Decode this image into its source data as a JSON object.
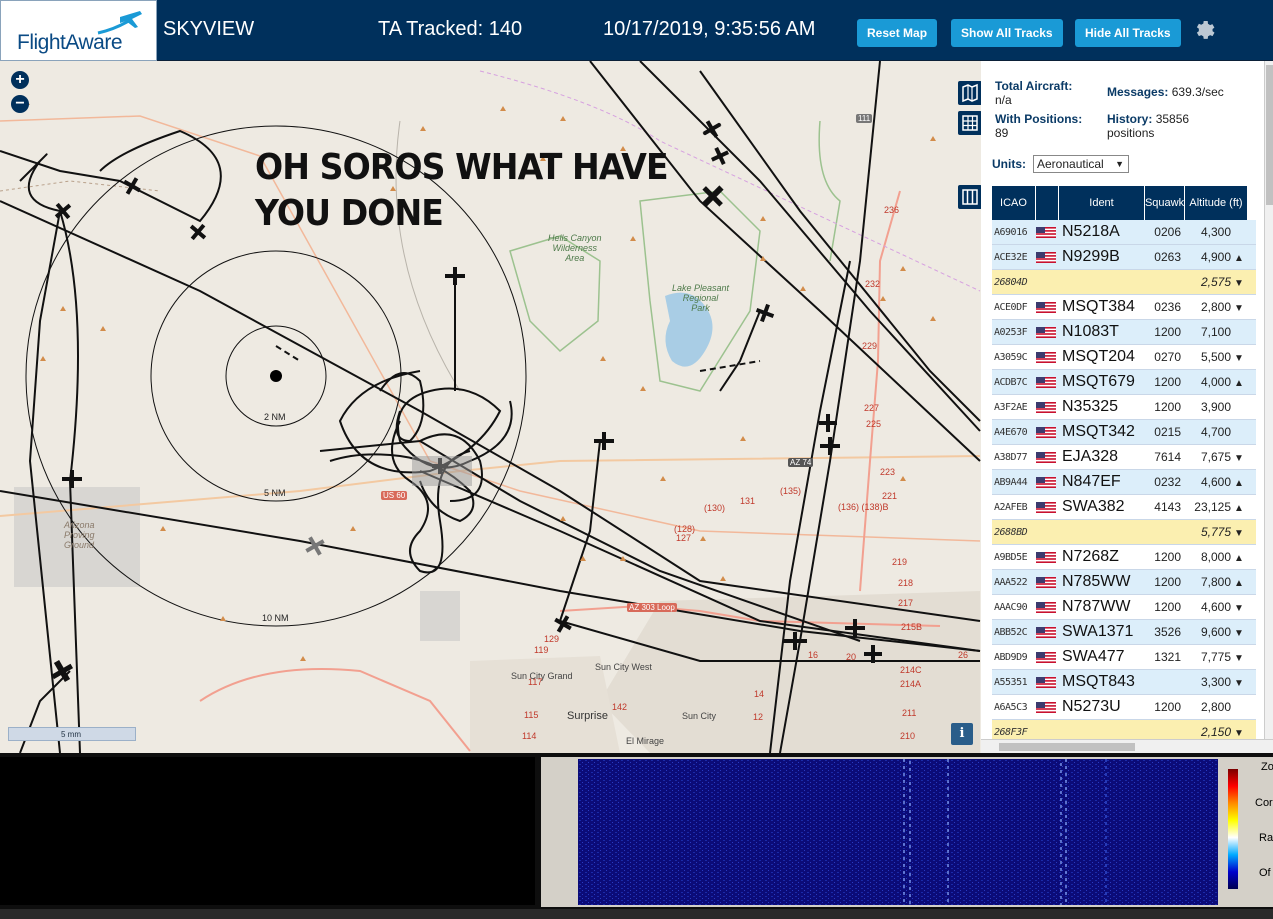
{
  "header": {
    "logo_text": "FlightAware",
    "app_name": "SKYVIEW",
    "ta_tracked": "TA Tracked: 140",
    "datetime": "10/17/2019, 9:35:56 AM",
    "buttons": {
      "reset_map": "Reset Map",
      "show_all": "Show All Tracks",
      "hide_all": "Hide All Tracks"
    }
  },
  "map": {
    "overlay_text_line1": "OH SOROS WHAT HAVE",
    "overlay_text_line2": "YOU DONE",
    "zoom_in": "+",
    "zoom_out": "−",
    "range_rings": [
      "2 NM",
      "5 NM",
      "10 NM"
    ],
    "places": {
      "hells_canyon": "Hells Canyon\nWilderness\nArea",
      "lake_pleasant": "Lake Pleasant\nRegional\nPark",
      "sun_city_grand": "Sun City Grand",
      "sun_city_west": "Sun City West",
      "surprise": "Surprise",
      "sun_city": "Sun City",
      "el_mirage": "El Mirage",
      "proving_ground": "Arizona\nProving\nGround"
    },
    "highways": [
      "US 60",
      "AZ 74",
      "AZ 303 Loop",
      "111",
      "236",
      "232",
      "229",
      "227",
      "225",
      "223",
      "221",
      "219",
      "218",
      "217",
      "215B",
      "214C",
      "214A",
      "211",
      "210",
      "(130)",
      "(135)",
      "131",
      "(136) (138)B",
      "(128)",
      "127",
      "129",
      "119",
      "117",
      "115",
      "114",
      "142",
      "14",
      "12",
      "16",
      "26",
      "20"
    ],
    "scale_label": "5 mm",
    "info_label": "i"
  },
  "sidebar": {
    "total_aircraft_label": "Total Aircraft:",
    "total_aircraft_value": "n/a",
    "with_positions_label": "With Positions:",
    "with_positions_value": "89",
    "messages_label": "Messages:",
    "messages_value": "639.3/sec",
    "history_label": "History:",
    "history_value": "35856 positions",
    "units_label": "Units:",
    "units_value": "Aeronautical",
    "columns": {
      "icao": "ICAO",
      "ident": "Ident",
      "squawk": "Squawk",
      "altitude": "Altitude (ft)"
    },
    "rows": [
      {
        "icao": "A69016",
        "flag": "us",
        "ident": "N5218A",
        "squawk": "0206",
        "alt": "4,300",
        "trend": "",
        "style": "blue"
      },
      {
        "icao": "ACE32E",
        "flag": "us",
        "ident": "N9299B",
        "squawk": "0263",
        "alt": "4,900",
        "trend": "▲",
        "style": "blue"
      },
      {
        "icao": "26804D",
        "flag": "",
        "ident": "",
        "squawk": "",
        "alt": "2,575",
        "trend": "▼",
        "style": "yellow"
      },
      {
        "icao": "ACE0DF",
        "flag": "us",
        "ident": "MSQT384",
        "squawk": "0236",
        "alt": "2,800",
        "trend": "▼",
        "style": "white"
      },
      {
        "icao": "A0253F",
        "flag": "us",
        "ident": "N1083T",
        "squawk": "1200",
        "alt": "7,100",
        "trend": "",
        "style": "blue"
      },
      {
        "icao": "A3059C",
        "flag": "us",
        "ident": "MSQT204",
        "squawk": "0270",
        "alt": "5,500",
        "trend": "▼",
        "style": "white"
      },
      {
        "icao": "ACDB7C",
        "flag": "us",
        "ident": "MSQT679",
        "squawk": "1200",
        "alt": "4,000",
        "trend": "▲",
        "style": "blue"
      },
      {
        "icao": "A3F2AE",
        "flag": "us",
        "ident": "N35325",
        "squawk": "1200",
        "alt": "3,900",
        "trend": "",
        "style": "white"
      },
      {
        "icao": "A4E670",
        "flag": "us",
        "ident": "MSQT342",
        "squawk": "0215",
        "alt": "4,700",
        "trend": "",
        "style": "blue"
      },
      {
        "icao": "A38D77",
        "flag": "us",
        "ident": "EJA328",
        "squawk": "7614",
        "alt": "7,675",
        "trend": "▼",
        "style": "white"
      },
      {
        "icao": "AB9A44",
        "flag": "us",
        "ident": "N847EF",
        "squawk": "0232",
        "alt": "4,600",
        "trend": "▲",
        "style": "blue"
      },
      {
        "icao": "A2AFEB",
        "flag": "us",
        "ident": "SWA382",
        "squawk": "4143",
        "alt": "23,125",
        "trend": "▲",
        "style": "white"
      },
      {
        "icao": "2688BD",
        "flag": "",
        "ident": "",
        "squawk": "",
        "alt": "5,775",
        "trend": "▼",
        "style": "yellow"
      },
      {
        "icao": "A9BD5E",
        "flag": "us",
        "ident": "N7268Z",
        "squawk": "1200",
        "alt": "8,000",
        "trend": "▲",
        "style": "white"
      },
      {
        "icao": "AAA522",
        "flag": "us",
        "ident": "N785WW",
        "squawk": "1200",
        "alt": "7,800",
        "trend": "▲",
        "style": "blue"
      },
      {
        "icao": "AAAC90",
        "flag": "us",
        "ident": "N787WW",
        "squawk": "1200",
        "alt": "4,600",
        "trend": "▼",
        "style": "white"
      },
      {
        "icao": "ABB52C",
        "flag": "us",
        "ident": "SWA1371",
        "squawk": "3526",
        "alt": "9,600",
        "trend": "▼",
        "style": "blue"
      },
      {
        "icao": "ABD9D9",
        "flag": "us",
        "ident": "SWA477",
        "squawk": "1321",
        "alt": "7,775",
        "trend": "▼",
        "style": "white"
      },
      {
        "icao": "A55351",
        "flag": "us",
        "ident": "MSQT843",
        "squawk": "",
        "alt": "3,300",
        "trend": "▼",
        "style": "blue"
      },
      {
        "icao": "A6A5C3",
        "flag": "us",
        "ident": "N5273U",
        "squawk": "1200",
        "alt": "2,800",
        "trend": "",
        "style": "white"
      },
      {
        "icao": "268F3F",
        "flag": "",
        "ident": "",
        "squawk": "",
        "alt": "2,150",
        "trend": "▼",
        "style": "yellow"
      }
    ]
  },
  "bottom_controls": [
    "Zo",
    "Cor",
    "Ra",
    "Of"
  ],
  "colors": {
    "header_bg": "#00305c",
    "button_bg": "#1a9ad6",
    "row_blue": "#dceefa",
    "row_yellow": "#fbefb0"
  }
}
